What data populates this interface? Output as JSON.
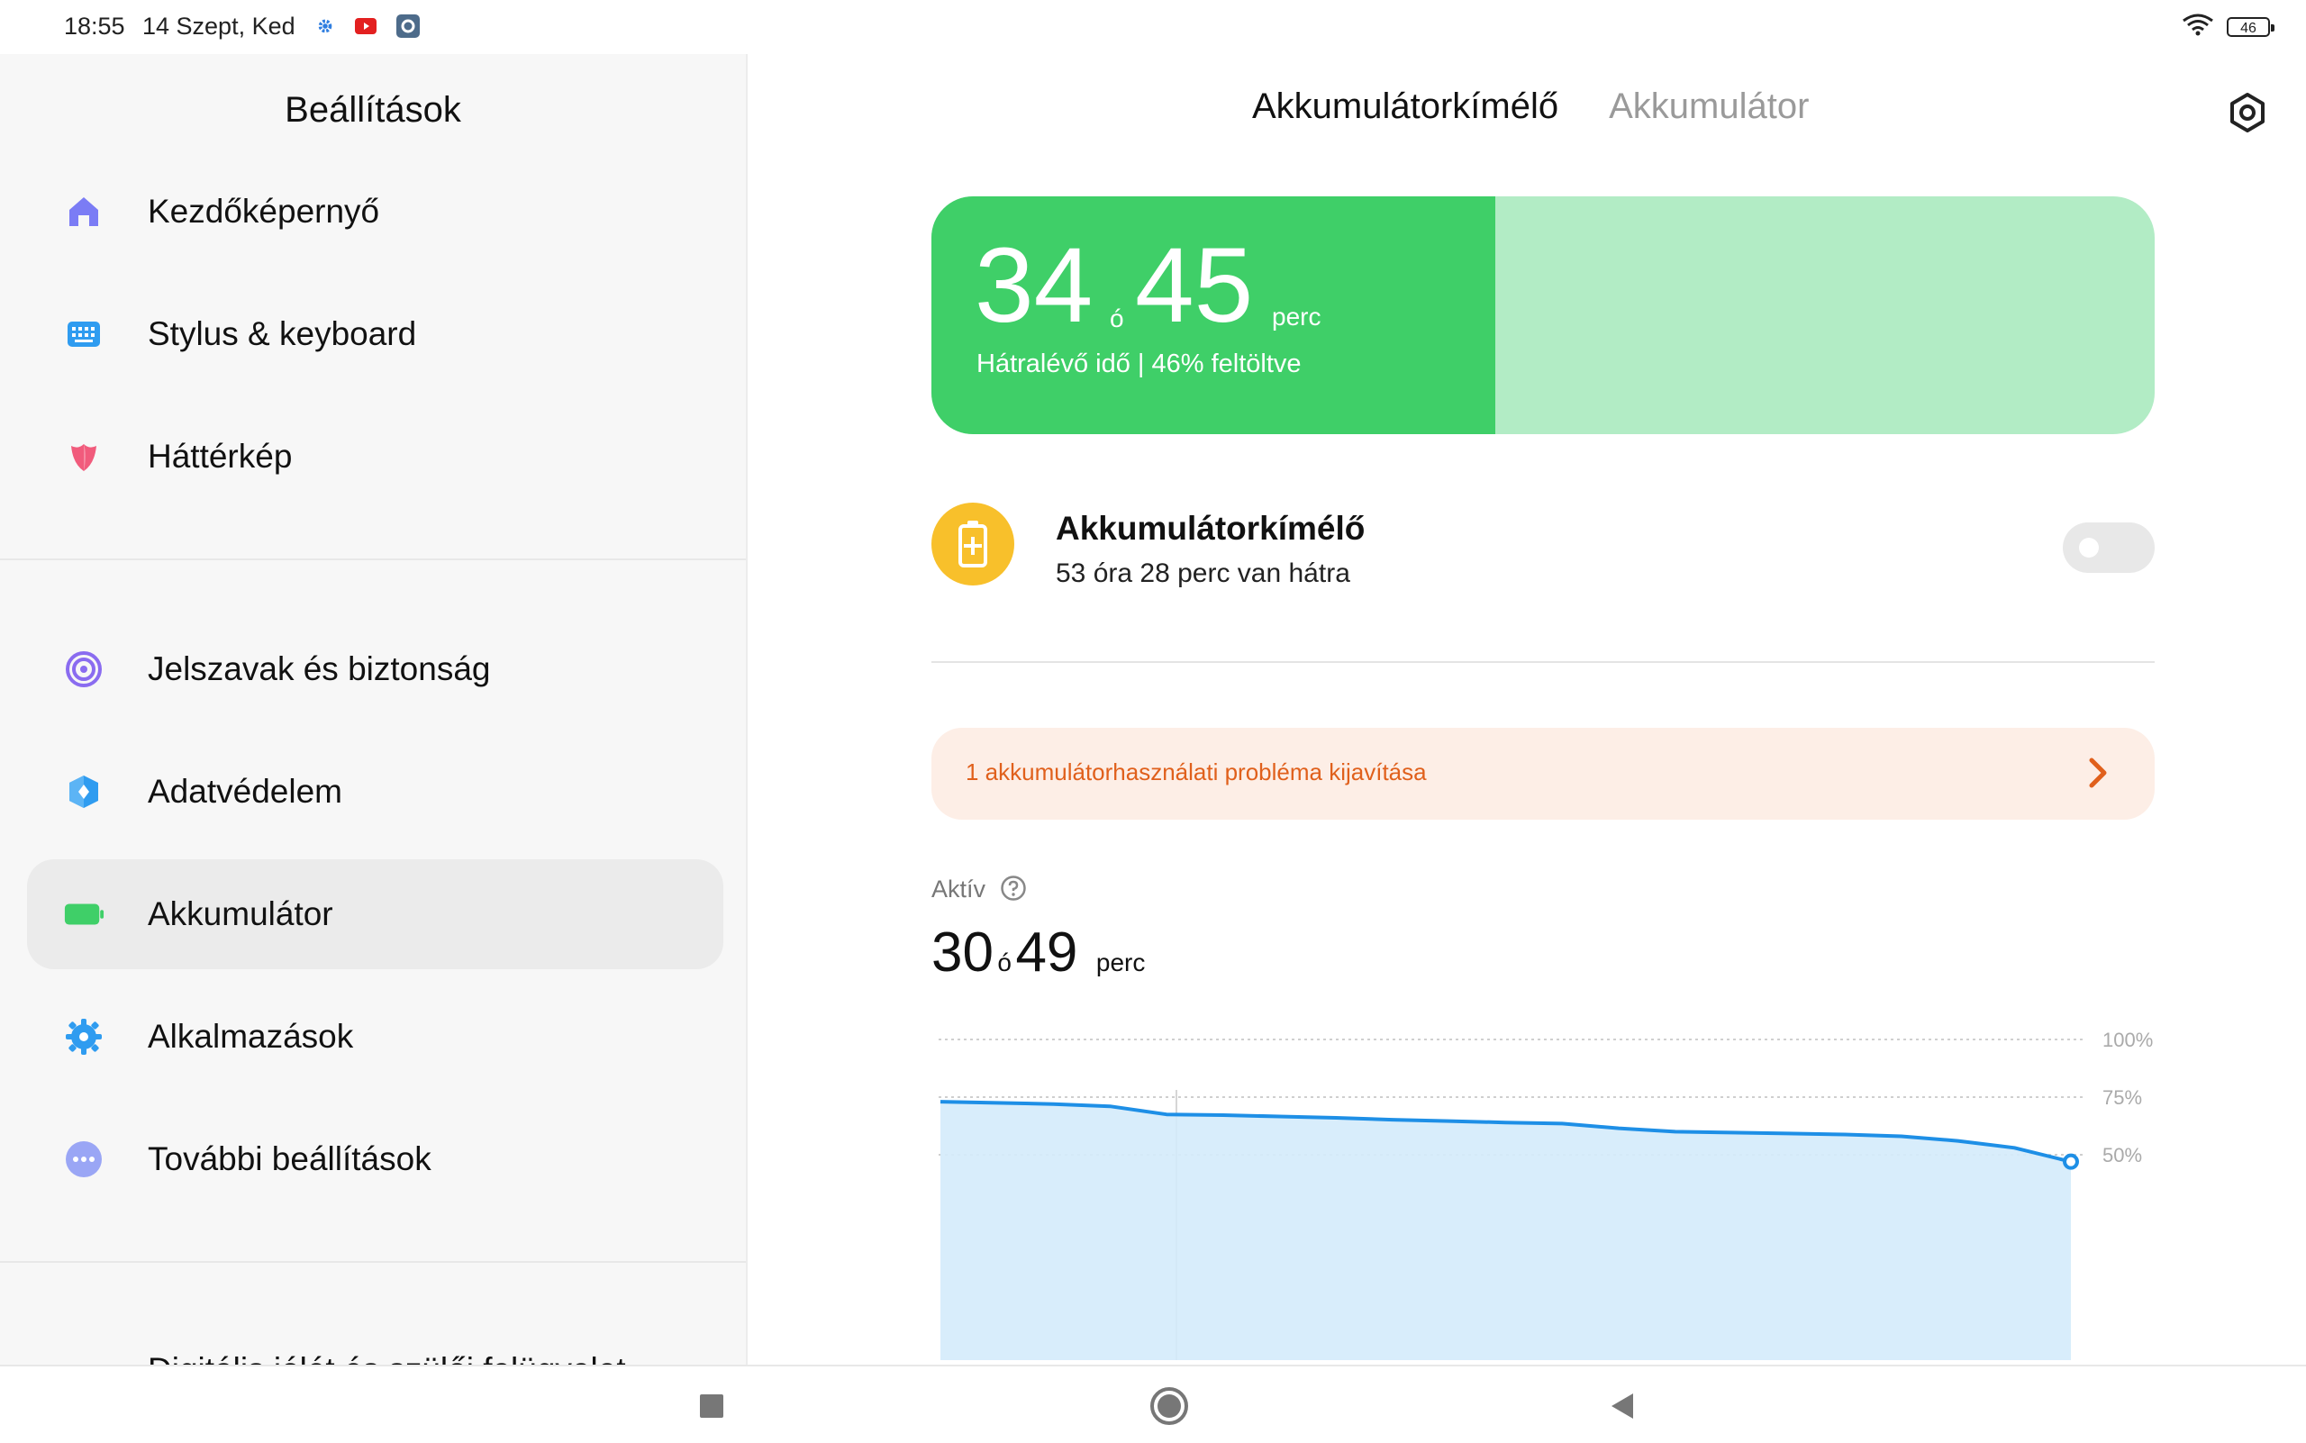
{
  "status": {
    "time": "18:55",
    "date": "14 Szept, Ked",
    "battery_level": "46",
    "icons_left": [
      "gear-small-icon",
      "youtube-icon",
      "settings-app-icon"
    ],
    "icons_right": [
      "wifi-icon",
      "battery-icon"
    ]
  },
  "sidebar": {
    "title": "Beállítások",
    "items": [
      {
        "label": "Kezdőképernyő",
        "icon": "home-icon",
        "color": "#7b7cf5"
      },
      {
        "label": "Stylus & keyboard",
        "icon": "keyboard-icon",
        "color": "#2f9cf0"
      },
      {
        "label": "Háttérkép",
        "icon": "tulip-icon",
        "color": "#f15b7c"
      },
      {
        "label": "Jelszavak és biztonság",
        "icon": "fingerprint-icon",
        "color": "#8a6cf0"
      },
      {
        "label": "Adatvédelem",
        "icon": "privacy-shield-icon",
        "color": "#2f9cf0"
      },
      {
        "label": "Akkumulátor",
        "icon": "battery-icon",
        "color": "#3fcf68"
      },
      {
        "label": "Alkalmazások",
        "icon": "apps-gear-icon",
        "color": "#2f9cf0"
      },
      {
        "label": "További beállítások",
        "icon": "more-dots-icon",
        "color": "#9aa6f5"
      }
    ],
    "cut_off_label": "Digitális jólét és szülői felügyelet"
  },
  "tabs": [
    {
      "label": "Akkumulátorkímélő",
      "active": true
    },
    {
      "label": "Akkumulátor",
      "active": false
    }
  ],
  "hero": {
    "hours": "34",
    "hours_unit": "ó",
    "minutes": "45",
    "minutes_unit": "perc",
    "subtitle": "Hátralévő idő | 46% feltöltve",
    "fill_percent": 46,
    "fill_color": "#3fcf68",
    "track_color": "#b2ecc5"
  },
  "saver": {
    "title": "Akkumulátorkímélő",
    "subtitle": "53 óra 28 perc van hátra",
    "enabled": false,
    "icon_color": "#f8c02b"
  },
  "issue": {
    "text": "1 akkumulátorhasználati probléma kijavítása",
    "color": "#e0601c"
  },
  "active": {
    "label": "Aktív",
    "hours": "30",
    "hours_unit": "ó",
    "minutes": "49",
    "minutes_unit": "perc"
  },
  "chart_data": {
    "type": "area",
    "y_ticks": [
      "100%",
      "75%",
      "50%"
    ],
    "ylim": [
      35,
      100
    ],
    "series": [
      {
        "values": [
          73,
          72.5,
          72,
          71,
          67.5,
          67.2,
          66.6,
          66,
          65.2,
          64.6,
          64,
          63.5,
          61.5,
          60,
          59.6,
          59.2,
          58.8,
          58,
          56,
          53,
          47
        ]
      }
    ],
    "line_color": "#1e8fe6",
    "fill_color": "#d4ebfb"
  },
  "navbar": {
    "buttons": [
      "recents-button",
      "home-button",
      "back-button"
    ]
  }
}
